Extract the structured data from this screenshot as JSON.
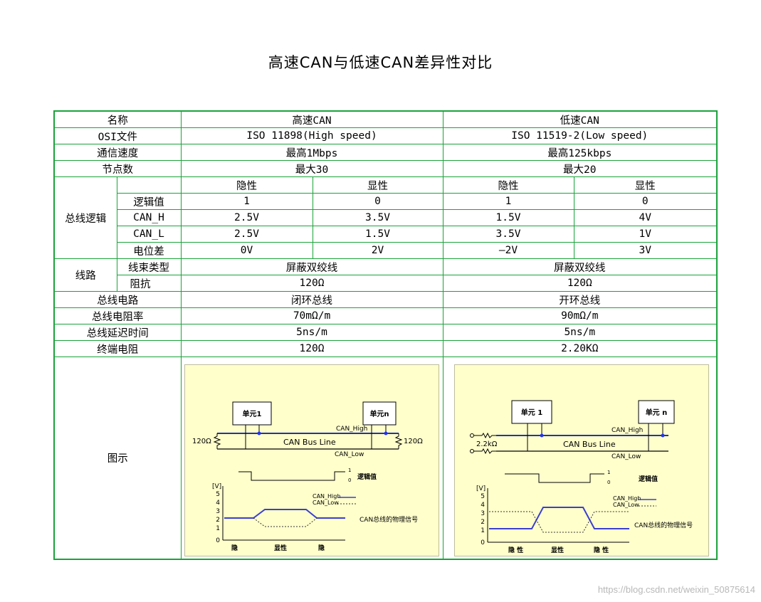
{
  "title": "高速CAN与低速CAN差异性对比",
  "header": {
    "name": "名称",
    "high": "高速CAN",
    "low": "低速CAN"
  },
  "rows": {
    "osi": {
      "label": "OSI文件",
      "high": "ISO 11898(High speed)",
      "low": "ISO 11519-2(Low speed)"
    },
    "rate": {
      "label": "通信速度",
      "high": "最高1Mbps",
      "low": "最高125kbps"
    },
    "nodes": {
      "label": "节点数",
      "high": "最大30",
      "low": "最大20"
    }
  },
  "logic": {
    "label": "总线逻辑",
    "recessive": "隐性",
    "dominant": "显性",
    "logic_value": {
      "label": "逻辑值",
      "h_rec": "1",
      "h_dom": "0",
      "l_rec": "1",
      "l_dom": "0"
    },
    "can_h": {
      "label": "CAN_H",
      "h_rec": "2.5V",
      "h_dom": "3.5V",
      "l_rec": "1.5V",
      "l_dom": "4V"
    },
    "can_l": {
      "label": "CAN_L",
      "h_rec": "2.5V",
      "h_dom": "1.5V",
      "l_rec": "3.5V",
      "l_dom": "1V"
    },
    "diff": {
      "label": "电位差",
      "h_rec": "0V",
      "h_dom": "2V",
      "l_rec": "—2V",
      "l_dom": "3V"
    }
  },
  "line": {
    "label": "线路",
    "harness": {
      "label": "线束类型",
      "high": "屏蔽双绞线",
      "low": "屏蔽双绞线"
    },
    "impedance": {
      "label": "阻抗",
      "high": "120Ω",
      "low": "120Ω"
    }
  },
  "rows2": {
    "circuit": {
      "label": "总线电路",
      "high": "闭环总线",
      "low": "开环总线"
    },
    "resistivity": {
      "label": "总线电阻率",
      "high": "70mΩ/m",
      "low": "90mΩ/m"
    },
    "delay": {
      "label": "总线延迟时间",
      "high": "5ns/m",
      "low": "5ns/m"
    },
    "termination": {
      "label": "终端电阻",
      "high": "120Ω",
      "low": "2.20KΩ"
    }
  },
  "illustration": {
    "label": "图示",
    "high": {
      "unit1": "单元1",
      "unitn": "单元n",
      "can_high": "CAN_High",
      "can_low": "CAN_Low",
      "bus": "CAN Bus Line",
      "res_left": "120Ω",
      "res_right": "120Ω",
      "logic": "逻辑值",
      "phys": "CAN总线的物理信号",
      "v_unit": "[V]",
      "one": "1",
      "zero": "0",
      "yticks": [
        "5",
        "4",
        "3",
        "2",
        "1",
        "0"
      ],
      "x_labels": [
        "隐",
        "显性",
        "隐"
      ]
    },
    "low": {
      "unit1": "单元 1",
      "unitn": "单元 n",
      "can_high": "CAN_High",
      "can_low": "CAN_Low",
      "bus": "CAN Bus Line",
      "res_left": "2.2kΩ",
      "logic": "逻辑值",
      "phys": "CAN总线的物理信号",
      "v_unit": "[V]",
      "one": "1",
      "zero": "0",
      "yticks": [
        "5",
        "4",
        "3",
        "2",
        "1",
        "0"
      ],
      "x_labels": [
        "隐 性",
        "显性",
        "隐 性"
      ]
    }
  },
  "watermark": "https://blog.csdn.net/weixin_50875614"
}
